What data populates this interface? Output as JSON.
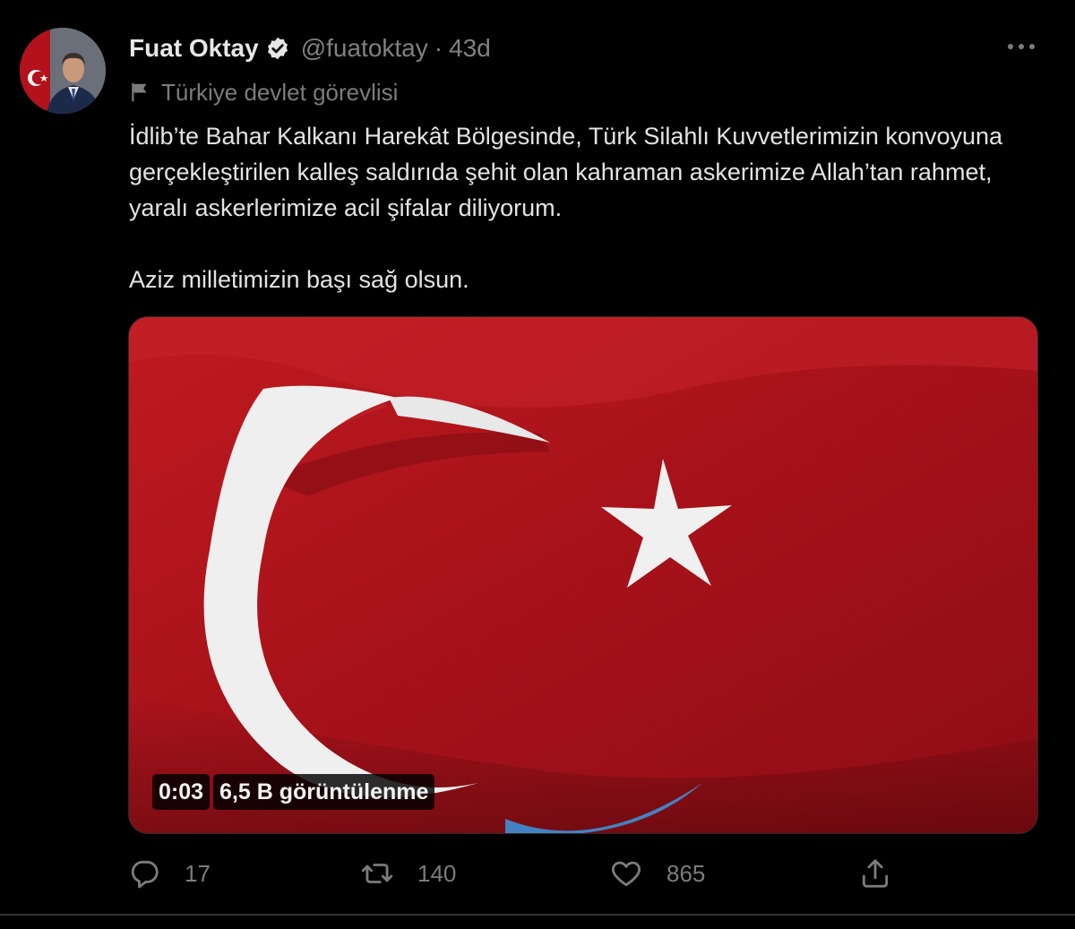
{
  "tweet": {
    "author_name": "Fuat Oktay",
    "handle": "@fuatoktay",
    "separator": "·",
    "time": "43d",
    "label": "Türkiye devlet görevlisi",
    "paragraphs": [
      "İdlib’te Bahar Kalkanı Harekât Bölgesinde, Türk Silahlı Kuvvetlerimizin konvoyuna gerçekleştirilen kalleş saldırıda şehit olan kahraman askerimize Allah’tan rahmet, yaralı askerlerimize acil şifalar diliyorum.",
      "Aziz milletimizin başı sağ olsun."
    ],
    "video": {
      "duration": "0:03",
      "views": "6,5 B görüntülenme"
    },
    "actions": {
      "reply_count": "17",
      "retweet_count": "140",
      "like_count": "865"
    }
  },
  "icons": {
    "verified": "verified-badge-icon",
    "more": "more-dots-icon",
    "label": "flag-icon",
    "reply": "reply-icon",
    "retweet": "retweet-icon",
    "like": "heart-icon",
    "share": "share-icon"
  },
  "colors": {
    "background": "#000000",
    "text": "#e3e3e3",
    "muted": "#7c7c7c",
    "flag_red": "#c8102e"
  }
}
